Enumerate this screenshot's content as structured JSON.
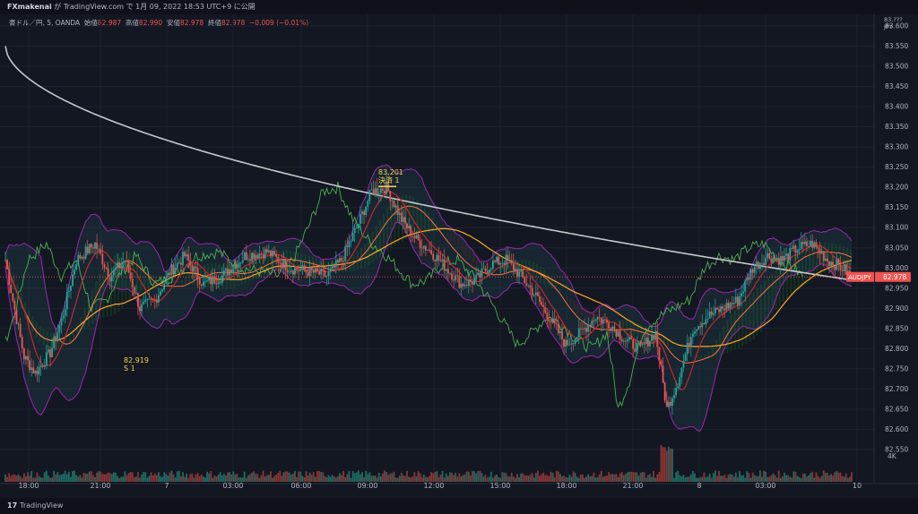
{
  "header": {
    "publisher": "FXmakenai",
    "caption": " が TradingView.com で 1月 09, 2022 18:53 UTC+9 に公開"
  },
  "legend": {
    "symbol": "豪ドル／円, 5, OANDA",
    "open_label": "始値",
    "open": "82.987",
    "high_label": "高値",
    "high": "82.990",
    "low_label": "安値",
    "low": "82.978",
    "close_label": "終値",
    "close": "82.978",
    "change": "−0.009 (−0.01%)"
  },
  "price_axis": {
    "currency_top": "83.???",
    "currency": "JPY",
    "ticks": [
      "83.600",
      "83.550",
      "83.500",
      "83.450",
      "83.400",
      "83.350",
      "83.300",
      "83.250",
      "83.200",
      "83.150",
      "83.100",
      "83.050",
      "83.000",
      "82.950",
      "82.900",
      "82.850",
      "82.800",
      "82.750",
      "82.700",
      "82.650",
      "82.600",
      "82.550"
    ],
    "volume_tick": "4K"
  },
  "price_tag": {
    "symbol": "AUDJPY",
    "value": "82.978"
  },
  "time_axis": {
    "ticks": [
      "18:00",
      "21:00",
      "7",
      "03:00",
      "06:00",
      "09:00",
      "12:00",
      "15:00",
      "18:00",
      "21:00",
      "8",
      "03:00",
      "10"
    ]
  },
  "annotations": {
    "high_value": "83.201",
    "high_label": "決済 1",
    "low_value": "82.919",
    "low_label": "S 1"
  },
  "footer": {
    "brand": "TradingView"
  },
  "colors": {
    "background": "#131722",
    "up": "#26a69a",
    "down": "#ef5350",
    "bollinger": "#9c27b0",
    "ma_long": "#c8c8c8",
    "ma_orange": "#ffa726",
    "ma_red": "#ef5350",
    "ma_green": "#4caf50",
    "accent_yellow": "#f5d547"
  },
  "chart_data": {
    "type": "candlestick",
    "symbol": "AUDJPY",
    "timeframe": "5",
    "x_ticks": [
      "18:00",
      "21:00",
      "7",
      "03:00",
      "06:00",
      "09:00",
      "12:00",
      "15:00",
      "18:00",
      "21:00",
      "8",
      "03:00",
      "10"
    ],
    "ylim": [
      82.55,
      83.62
    ],
    "last_price": 82.978,
    "anchors": [
      [
        0,
        83.02
      ],
      [
        4,
        82.92
      ],
      [
        10,
        82.78
      ],
      [
        16,
        82.74
      ],
      [
        24,
        82.79
      ],
      [
        30,
        82.87
      ],
      [
        38,
        83.02
      ],
      [
        48,
        83.06
      ],
      [
        56,
        82.98
      ],
      [
        64,
        83.02
      ],
      [
        72,
        82.9
      ],
      [
        80,
        82.92
      ],
      [
        88,
        82.99
      ],
      [
        96,
        83.03
      ],
      [
        106,
        82.96
      ],
      [
        116,
        82.98
      ],
      [
        128,
        83.03
      ],
      [
        140,
        83.04
      ],
      [
        152,
        83.0
      ],
      [
        164,
        82.99
      ],
      [
        172,
        82.98
      ],
      [
        180,
        83.02
      ],
      [
        188,
        83.1
      ],
      [
        196,
        83.19
      ],
      [
        204,
        83.2
      ],
      [
        212,
        83.12
      ],
      [
        220,
        83.07
      ],
      [
        228,
        83.04
      ],
      [
        236,
        83.0
      ],
      [
        244,
        82.96
      ],
      [
        252,
        82.97
      ],
      [
        260,
        83.01
      ],
      [
        268,
        83.02
      ],
      [
        276,
        82.98
      ],
      [
        284,
        82.93
      ],
      [
        292,
        82.87
      ],
      [
        300,
        82.81
      ],
      [
        308,
        82.84
      ],
      [
        316,
        82.88
      ],
      [
        324,
        82.86
      ],
      [
        332,
        82.82
      ],
      [
        340,
        82.8
      ],
      [
        348,
        82.84
      ],
      [
        354,
        82.65
      ],
      [
        360,
        82.72
      ],
      [
        368,
        82.85
      ],
      [
        376,
        82.88
      ],
      [
        384,
        82.9
      ],
      [
        392,
        82.92
      ],
      [
        400,
        83.0
      ],
      [
        408,
        83.03
      ],
      [
        416,
        83.02
      ],
      [
        424,
        83.05
      ],
      [
        432,
        83.06
      ],
      [
        440,
        83.02
      ],
      [
        448,
        83.0
      ],
      [
        453,
        82.978
      ]
    ]
  }
}
